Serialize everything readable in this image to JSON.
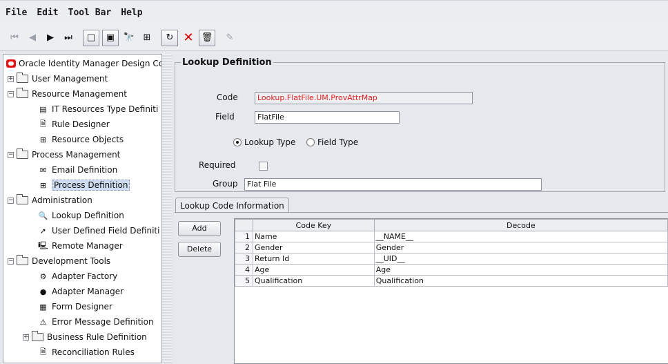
{
  "menu": [
    "File",
    "Edit",
    "Tool Bar",
    "Help"
  ],
  "tree": {
    "root": "Oracle Identity Manager Design Co",
    "items": [
      {
        "label": "User Management",
        "toggle": "+"
      },
      {
        "label": "Resource Management",
        "toggle": "−"
      },
      {
        "label": "IT Resources Type Definiti"
      },
      {
        "label": "Rule Designer"
      },
      {
        "label": "Resource Objects"
      },
      {
        "label": "Process Management",
        "toggle": "−"
      },
      {
        "label": "Email Definition"
      },
      {
        "label": "Process Definition"
      },
      {
        "label": "Administration",
        "toggle": "−"
      },
      {
        "label": "Lookup Definition"
      },
      {
        "label": "User Defined Field Definiti"
      },
      {
        "label": "Remote Manager"
      },
      {
        "label": "Development Tools",
        "toggle": "−"
      },
      {
        "label": "Adapter Factory"
      },
      {
        "label": "Adapter Manager"
      },
      {
        "label": "Form Designer"
      },
      {
        "label": "Error Message Definition"
      },
      {
        "label": "Business Rule Definition",
        "toggle": "+"
      },
      {
        "label": "Reconciliation Rules"
      }
    ]
  },
  "form": {
    "title": "Lookup Definition",
    "code_label": "Code",
    "code_value": "Lookup.FlatFile.UM.ProvAttrMap",
    "field_label": "Field",
    "field_value": "FlatFile",
    "radio_lookup": "Lookup Type",
    "radio_field": "Field Type",
    "required_label": "Required",
    "group_label": "Group",
    "group_value": "Flat File"
  },
  "tab": {
    "label": "Lookup Code Information",
    "add": "Add",
    "delete": "Delete"
  },
  "table": {
    "headers": [
      "Code Key",
      "Decode"
    ],
    "rows": [
      {
        "n": "1",
        "key": "Name",
        "decode": "__NAME__"
      },
      {
        "n": "2",
        "key": "Gender",
        "decode": "Gender"
      },
      {
        "n": "3",
        "key": "Return Id",
        "decode": "__UID__"
      },
      {
        "n": "4",
        "key": "Age",
        "decode": "Age"
      },
      {
        "n": "5",
        "key": "Qualification",
        "decode": "Qualification"
      }
    ]
  }
}
